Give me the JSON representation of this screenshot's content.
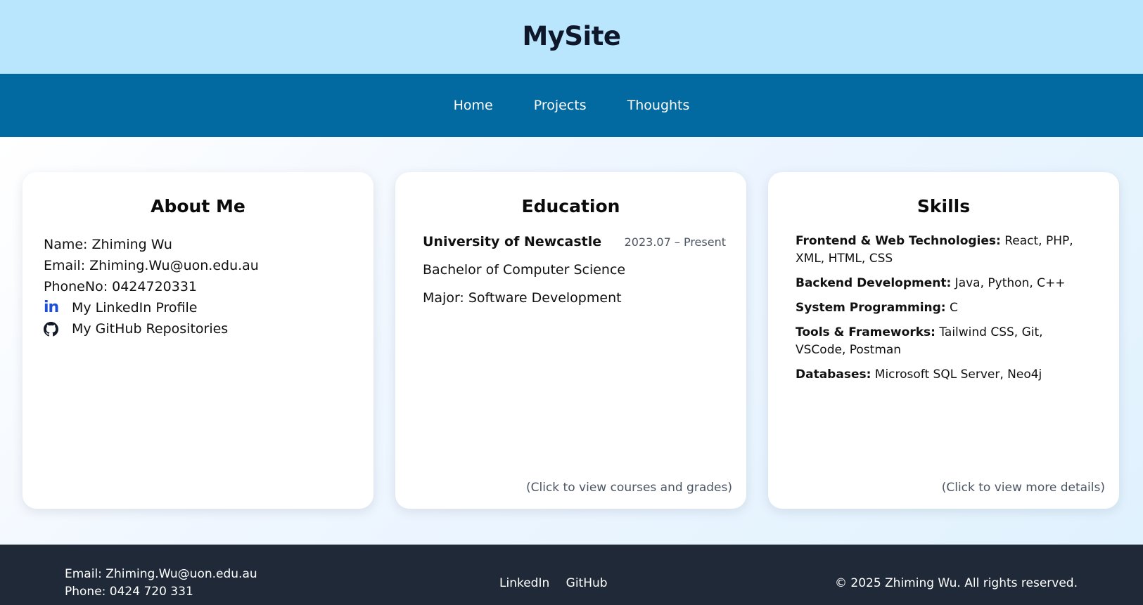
{
  "header": {
    "site_title": "MySite"
  },
  "nav": {
    "items": [
      "Home",
      "Projects",
      "Thoughts"
    ]
  },
  "about": {
    "title": "About Me",
    "name": "Name: Zhiming Wu",
    "email": "Email: Zhiming.Wu@uon.edu.au",
    "phone": "PhoneNo: 0424720331",
    "linkedin_icon": "in",
    "linkedin_label": "My LinkedIn Profile",
    "github_label": "My GitHub Repositories"
  },
  "education": {
    "title": "Education",
    "university": "University of Newcastle",
    "dates": "2023.07 – Present",
    "degree": "Bachelor of Computer Science",
    "major": "Major: Software Development",
    "hint": "(Click to view courses and grades)"
  },
  "skills": {
    "title": "Skills",
    "items": [
      {
        "category": "Frontend & Web Technologies:",
        "value": " React, PHP, XML, HTML, CSS"
      },
      {
        "category": "Backend Development:",
        "value": " Java, Python, C++"
      },
      {
        "category": "System Programming:",
        "value": " C"
      },
      {
        "category": "Tools & Frameworks:",
        "value": " Tailwind CSS, Git, VSCode, Postman"
      },
      {
        "category": "Databases:",
        "value": " Microsoft SQL Server, Neo4j"
      }
    ],
    "hint": "(Click to view more details)"
  },
  "footer": {
    "email": "Email: Zhiming.Wu@uon.edu.au",
    "phone": "Phone: 0424 720 331",
    "links": [
      "LinkedIn",
      "GitHub"
    ],
    "copyright": "© 2025 Zhiming Wu. All rights reserved."
  },
  "colors": {
    "header_bg": "#bae6fd",
    "nav_bg": "#0369a1",
    "footer_bg": "#1f2937",
    "linkedin_blue": "#1d4ed8"
  },
  "icons": {
    "linkedin": "linkedin-icon",
    "github": "github-icon"
  }
}
